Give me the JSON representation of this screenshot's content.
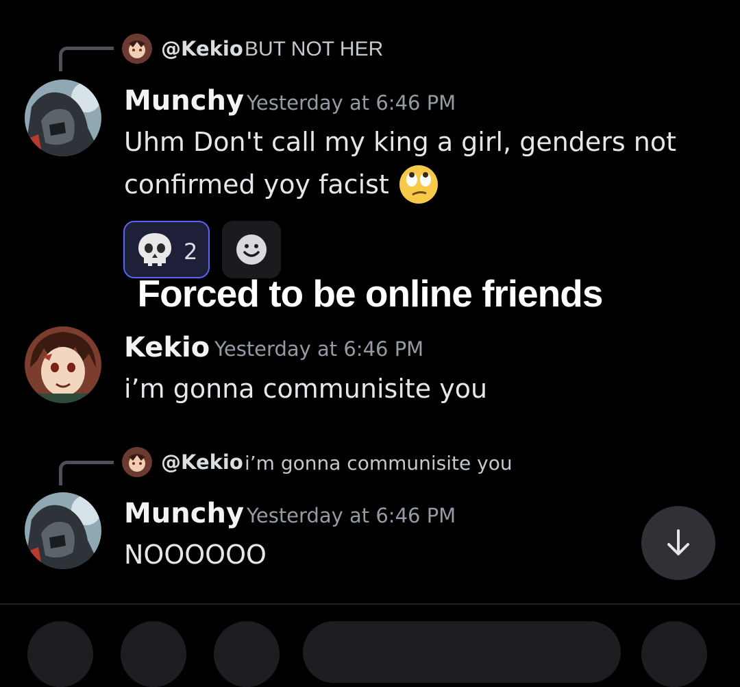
{
  "messages": [
    {
      "reply": {
        "author": "@Kekio",
        "text": "BUT NOT HER"
      },
      "author": "Munchy",
      "timestamp": "Yesterday at 6:46 PM",
      "lines": [
        "Uhm Don't call my king a girl, genders not",
        "confirmed yoy facist"
      ],
      "emoji": "rolling-eyes-emoji",
      "reaction": {
        "icon": "skull-icon",
        "count": "2"
      }
    },
    {
      "author": "Kekio",
      "timestamp": "Yesterday at 6:46 PM",
      "lines": [
        "i’m gonna communisite you"
      ]
    },
    {
      "reply": {
        "author": "@Kekio",
        "text": "i’m gonna communisite you"
      },
      "author": "Munchy",
      "timestamp": "Yesterday at 6:46 PM",
      "lines": [
        "NOOOOOO"
      ]
    }
  ],
  "caption": "Forced to be online friends",
  "colors": {
    "background": "#000000",
    "accent": "#5865f2",
    "muted": "#949ba4"
  }
}
